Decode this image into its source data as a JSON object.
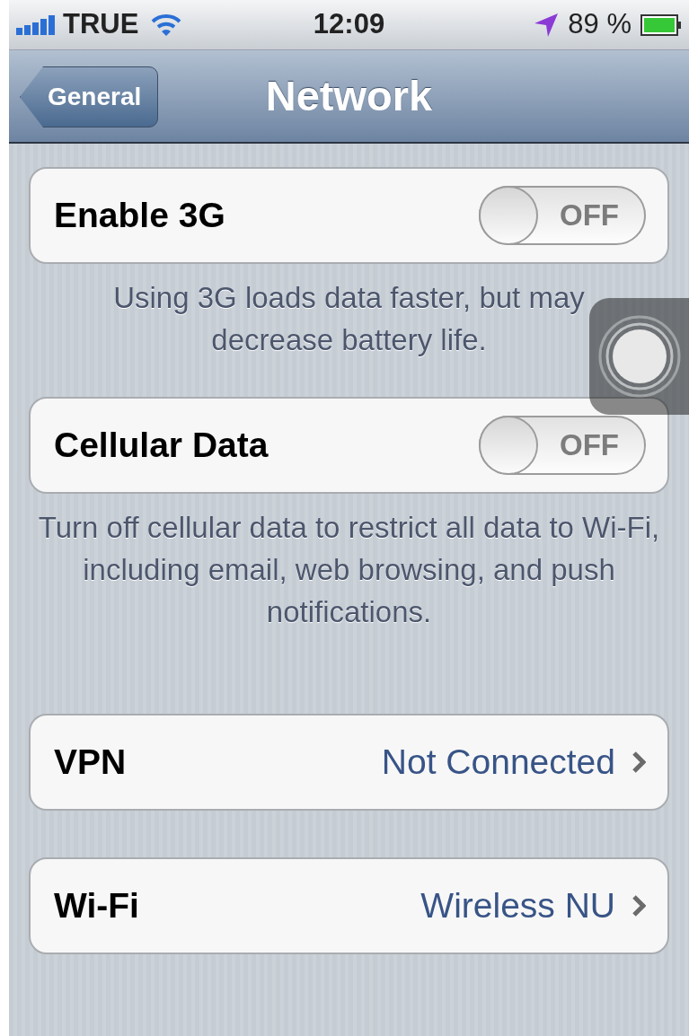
{
  "status_bar": {
    "carrier": "TRUE",
    "time": "12:09",
    "battery": "89 %"
  },
  "nav_bar": {
    "back_button": "General",
    "title": "Network"
  },
  "sections": [
    {
      "rows": [
        {
          "kind": "toggle",
          "label": "Enable 3G",
          "on": false,
          "state_text": "OFF"
        }
      ],
      "footer": "Using 3G loads data faster, but may decrease battery life."
    },
    {
      "rows": [
        {
          "kind": "toggle",
          "label": "Cellular Data",
          "on": false,
          "state_text": "OFF"
        }
      ],
      "footer": "Turn off cellular data to restrict all data to Wi-Fi, including email, web browsing, and push notifications."
    },
    {
      "rows": [
        {
          "kind": "link",
          "label": "VPN",
          "value": "Not Connected"
        }
      ]
    },
    {
      "rows": [
        {
          "kind": "link",
          "label": "Wi-Fi",
          "value": "Wireless NU"
        }
      ]
    }
  ]
}
